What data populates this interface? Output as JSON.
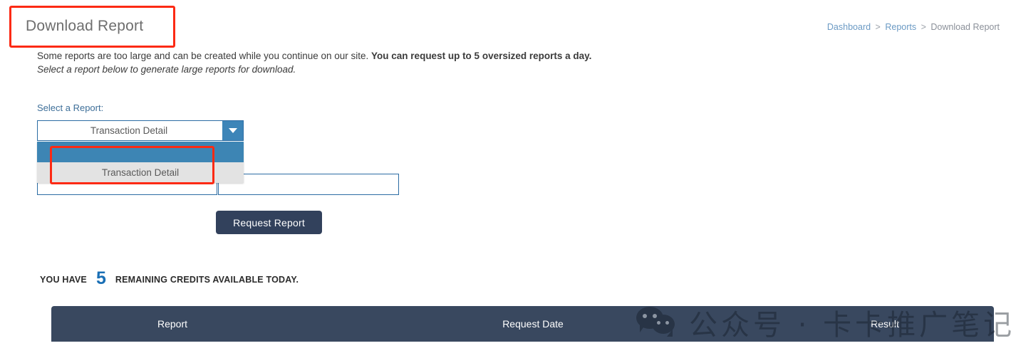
{
  "page": {
    "title": "Download Report"
  },
  "breadcrumb": {
    "root": "Dashboard",
    "separator": ">",
    "middle": "Reports",
    "current": "Download Report"
  },
  "intro": {
    "line1_plain": "Some reports are too large and can be created while you continue on our site. ",
    "line1_bold": "You can request up to 5 oversized reports a day.",
    "line2": "Select a report below to generate large reports for download."
  },
  "form": {
    "select_label": "Select a Report:",
    "selected_report": "Transaction Detail",
    "dropdown_options": [
      "",
      "Transaction Detail"
    ],
    "input_left_value": "",
    "input_left_placeholder": "",
    "input_right_value": "",
    "input_right_placeholder": "",
    "submit_label": "Request Report"
  },
  "credits": {
    "prefix": "YOU HAVE",
    "count": "5",
    "suffix": "REMAINING CREDITS AVAILABLE TODAY."
  },
  "results_table": {
    "columns": [
      "Report",
      "Request Date",
      "Result"
    ],
    "rows": []
  },
  "watermark": {
    "icon": "wechat-icon",
    "text": "公众号 · 卡卡推广笔记"
  },
  "colors": {
    "annotation": "#fc2a14",
    "accent_blue": "#3d85b8",
    "link_blue": "#6b9ac4",
    "dark_navy": "#39485f",
    "button_navy": "#32415c",
    "credit_number": "#1a6fb5",
    "input_border": "#2b6ca3"
  }
}
